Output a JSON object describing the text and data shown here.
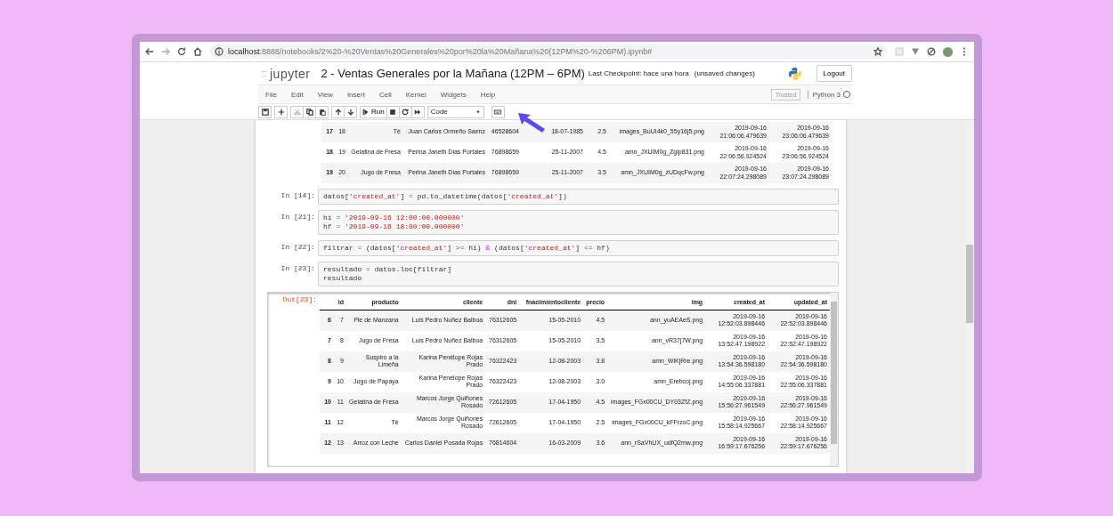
{
  "browser": {
    "url_host": "localhost",
    "url_rest": ":8888/notebooks/2%20-%20Ventas%20Generales%20por%20la%20Mañana%20(12PM%20-%206PM).ipynb#"
  },
  "header": {
    "logo_text": "jupyter",
    "title": "2 - Ventas Generales por la Mañana (12PM – 6PM)",
    "checkpoint": "Last Checkpoint: hace una hora",
    "unsaved": "(unsaved changes)",
    "logout": "Logout"
  },
  "menu": [
    "File",
    "Edit",
    "View",
    "Insert",
    "Cell",
    "Kernel",
    "Widgets",
    "Help"
  ],
  "trusted": "Trusted",
  "kernel": {
    "name": "Python 3",
    "busy": false
  },
  "toolbar": {
    "run": "Run",
    "cell_type": "Code"
  },
  "cells": [
    {
      "kind": "table",
      "rows": [
        [
          "17",
          "18",
          "Tè",
          "Juan Carlos Ormeño Saenz",
          "46528604",
          "18-07-1985",
          "2.5",
          "images_BuUI4k0_55y16j5.png",
          "2019-09-16 21:06:06.479639",
          "2019-09-16 23:06:06.479639"
        ],
        [
          "18",
          "19",
          "Gelatina de Fresa",
          "Perina Janeth Dias Portales",
          "76898659",
          "25-11-2007",
          "4.5",
          "amn_JXUIM0g_Zgip831.png",
          "2019-09-16 22:06:56.924524",
          "2019-09-16 23:06:56.924524"
        ],
        [
          "19",
          "20",
          "Jugo de Fresa",
          "Perina Janeth Dias Portales",
          "76898659",
          "25-11-2007",
          "3.5",
          "amn_JXUIM0g_zUDqcFw.png",
          "2019-09-16 22:07:24.298089",
          "2019-09-16 23:07:24.298089"
        ]
      ]
    },
    {
      "kind": "code",
      "prompt": "In [14]:",
      "lines": [
        [
          {
            "kind": "name",
            "text": "datos["
          },
          {
            "kind": "string",
            "text": "'created_at'"
          },
          {
            "kind": "name",
            "text": "] "
          },
          {
            "kind": "operator",
            "text": "="
          },
          {
            "kind": "name",
            "text": " pd.to_datetime(datos["
          },
          {
            "kind": "string",
            "text": "'created_at'"
          },
          {
            "kind": "name",
            "text": "])"
          }
        ]
      ]
    },
    {
      "kind": "code",
      "prompt": "In [21]:",
      "lines": [
        [
          {
            "kind": "name",
            "text": "hi "
          },
          {
            "kind": "operator",
            "text": "="
          },
          {
            "kind": "string",
            "text": " '2019-09-16 12:00:00.000000'"
          }
        ],
        [
          {
            "kind": "name",
            "text": "hf "
          },
          {
            "kind": "operator",
            "text": "="
          },
          {
            "kind": "string",
            "text": " '2019-09-16 18:00:00.000000'"
          }
        ]
      ]
    },
    {
      "kind": "code",
      "prompt": "In [22]:",
      "lines": [
        [
          {
            "kind": "name",
            "text": "filtrar "
          },
          {
            "kind": "operator",
            "text": "="
          },
          {
            "kind": "name",
            "text": " (datos["
          },
          {
            "kind": "string",
            "text": "'created_at'"
          },
          {
            "kind": "name",
            "text": "] "
          },
          {
            "kind": "operator",
            "text": ">="
          },
          {
            "kind": "name",
            "text": " hi) "
          },
          {
            "kind": "operator",
            "text": "&"
          },
          {
            "kind": "name",
            "text": " (datos["
          },
          {
            "kind": "string",
            "text": "'created_at'"
          },
          {
            "kind": "name",
            "text": "] "
          },
          {
            "kind": "operator",
            "text": "<="
          },
          {
            "kind": "name",
            "text": " hf)"
          }
        ]
      ]
    },
    {
      "kind": "code",
      "prompt": "In [23]:",
      "lines": [
        [
          {
            "kind": "name",
            "text": "resultado "
          },
          {
            "kind": "operator",
            "text": "="
          },
          {
            "kind": "name",
            "text": " datos.loc[filtrar]"
          }
        ],
        [
          {
            "kind": "name",
            "text": "resultado"
          }
        ]
      ]
    },
    {
      "kind": "table",
      "prompt": "Out[23]:",
      "columns": [
        null,
        "id",
        "producto",
        "cliente",
        "dni",
        "fnacimientocliente",
        "precio",
        "img",
        "created_at",
        "updated_at"
      ],
      "rows": [
        [
          "6",
          "7",
          "Pie de Manzana",
          "Luis Pedro Nuñez Balboa",
          "76312605",
          "15-05-2010",
          "4.5",
          "ann_yuAEAeS.png",
          "2019-09-16 12:52:03.898446",
          "2019-09-16 22:52:03.898446"
        ],
        [
          "7",
          "8",
          "Jugo de Fresa",
          "Luis Pedro Nuñez Balboa",
          "76312605",
          "15-05-2010",
          "3.5",
          "ann_vR37j7W.png",
          "2019-09-16 13:52:47.198922",
          "2019-09-16 22:52:47.198922"
        ],
        [
          "8",
          "9",
          "Suspiro a la Limeña",
          "Karina Penélope Rojas Prado",
          "76322423",
          "12-08-2003",
          "3.8",
          "amn_WlKjRre.png",
          "2019-09-16 13:54:36.598180",
          "2019-09-16 22:54:36.598180"
        ],
        [
          "9",
          "10",
          "Jugo de Papaya",
          "Karina Penélope Rojas Prado",
          "76322423",
          "12-08-2003",
          "3.0",
          "amn_Erebcoj.png",
          "2019-09-16 14:55:06.337881",
          "2019-09-16 22:55:06.337881"
        ],
        [
          "10",
          "11",
          "Gelatina de Fresa",
          "Marcos Jorge Quiñones Rosado",
          "72612605",
          "17-04-1950",
          "4.5",
          "images_FGx00CU_DY03ZfZ.png",
          "2019-09-16 15:56:27.961549",
          "2019-09-16 22:56:27.961549"
        ],
        [
          "11",
          "12",
          "Tè",
          "Marcos Jorge Quiñones Rosado",
          "72612605",
          "17-04-1950",
          "2.5",
          "images_FGx00CU_kFFrzoC.png",
          "2019-09-16 15:58:14.925667",
          "2019-09-16 22:58:14.925667"
        ],
        [
          "12",
          "13",
          "Arroz con Leche",
          "Carlos Daniel Posada Rojas",
          "76814604",
          "16-03-2009",
          "3.6",
          "ann_rSaVhUX_udfQ2mw.png",
          "2019-09-16 16:59:17.676256",
          "2019-09-16 22:59:17.676256"
        ]
      ]
    }
  ]
}
